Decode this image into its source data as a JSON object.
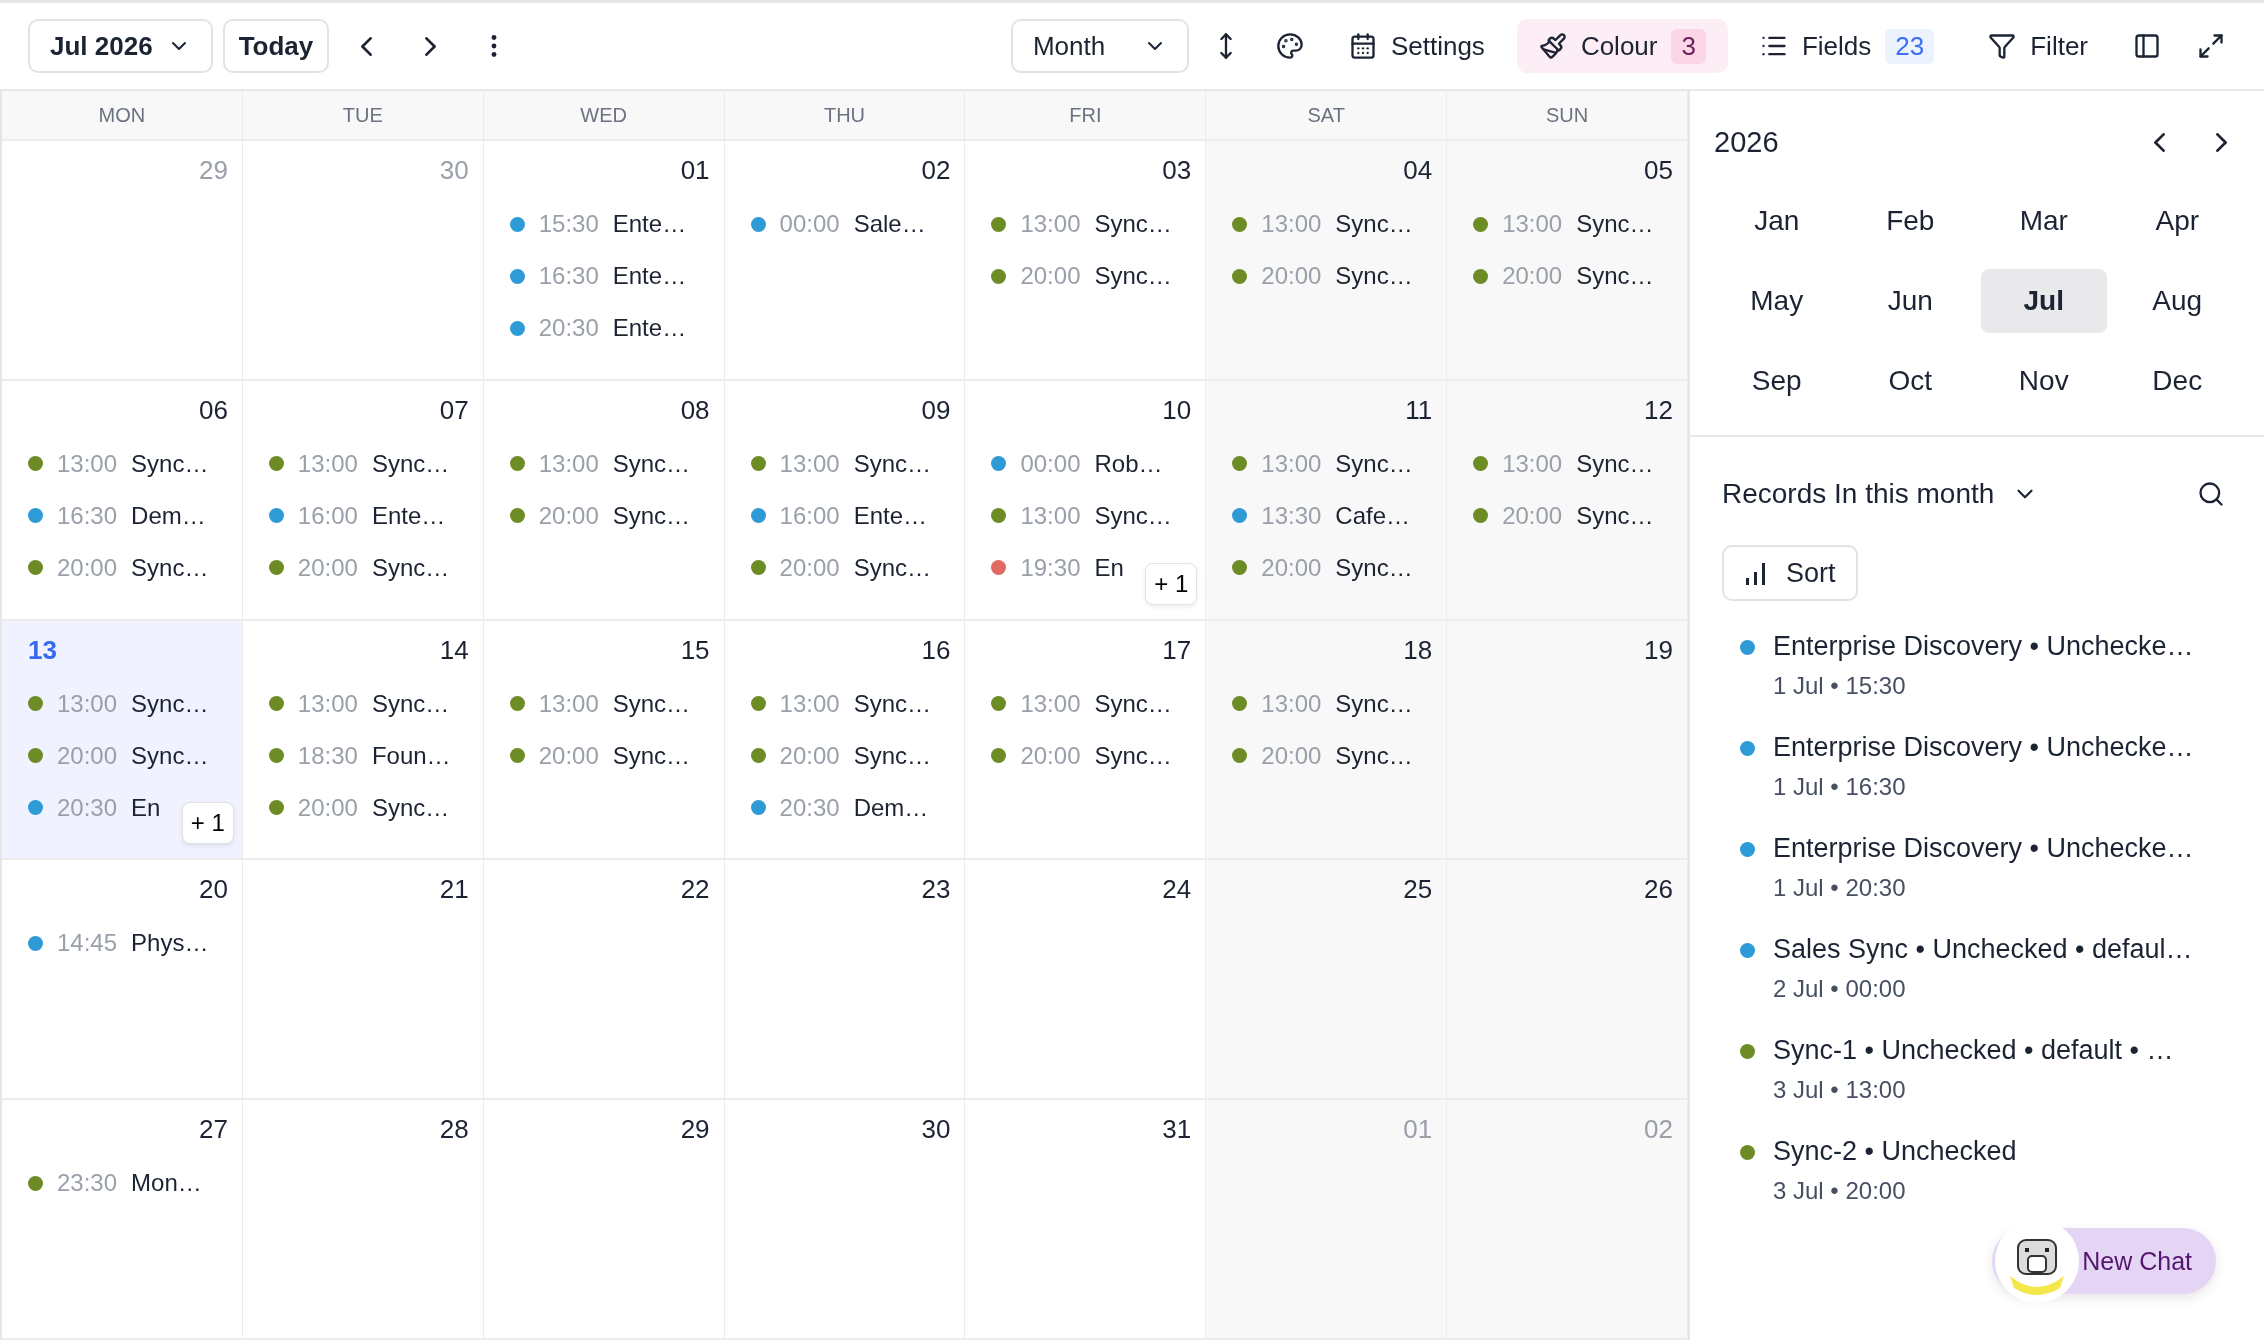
{
  "toolbar": {
    "date_picker": "Jul 2026",
    "today": "Today",
    "view": "Month",
    "settings": "Settings",
    "colour": {
      "label": "Colour",
      "count": "3"
    },
    "fields": {
      "label": "Fields",
      "count": "23"
    },
    "filter": "Filter"
  },
  "weekdays": [
    "MON",
    "TUE",
    "WED",
    "THU",
    "FRI",
    "SAT",
    "SUN"
  ],
  "weeks": [
    {
      "days": [
        {
          "date": "29",
          "in_month": false,
          "today": false
        },
        {
          "date": "30",
          "in_month": false,
          "today": false
        },
        {
          "date": "01",
          "in_month": true,
          "today": false,
          "events": [
            {
              "color": "#2e9bd6",
              "time": "15:30",
              "title": "Ente…"
            },
            {
              "color": "#2e9bd6",
              "time": "16:30",
              "title": "Ente…"
            },
            {
              "color": "#2e9bd6",
              "time": "20:30",
              "title": "Ente…"
            }
          ]
        },
        {
          "date": "02",
          "in_month": true,
          "today": false,
          "events": [
            {
              "color": "#2e9bd6",
              "time": "00:00",
              "title": "Sale…"
            }
          ]
        },
        {
          "date": "03",
          "in_month": true,
          "today": false,
          "events": [
            {
              "color": "#6e8c25",
              "time": "13:00",
              "title": "Sync…"
            },
            {
              "color": "#6e8c25",
              "time": "20:00",
              "title": "Sync…"
            }
          ]
        },
        {
          "date": "04",
          "in_month": true,
          "today": false,
          "events": [
            {
              "color": "#6e8c25",
              "time": "13:00",
              "title": "Sync…"
            },
            {
              "color": "#6e8c25",
              "time": "20:00",
              "title": "Sync…"
            }
          ]
        },
        {
          "date": "05",
          "in_month": true,
          "today": false,
          "events": [
            {
              "color": "#6e8c25",
              "time": "13:00",
              "title": "Sync…"
            },
            {
              "color": "#6e8c25",
              "time": "20:00",
              "title": "Sync…"
            }
          ]
        }
      ]
    },
    {
      "days": [
        {
          "date": "06",
          "in_month": true,
          "today": false,
          "events": [
            {
              "color": "#6e8c25",
              "time": "13:00",
              "title": "Sync…"
            },
            {
              "color": "#2e9bd6",
              "time": "16:30",
              "title": "Dem…"
            },
            {
              "color": "#6e8c25",
              "time": "20:00",
              "title": "Sync…"
            }
          ]
        },
        {
          "date": "07",
          "in_month": true,
          "today": false,
          "events": [
            {
              "color": "#6e8c25",
              "time": "13:00",
              "title": "Sync…"
            },
            {
              "color": "#2e9bd6",
              "time": "16:00",
              "title": "Ente…"
            },
            {
              "color": "#6e8c25",
              "time": "20:00",
              "title": "Sync…"
            }
          ]
        },
        {
          "date": "08",
          "in_month": true,
          "today": false,
          "events": [
            {
              "color": "#6e8c25",
              "time": "13:00",
              "title": "Sync…"
            },
            {
              "color": "#6e8c25",
              "time": "20:00",
              "title": "Sync…"
            }
          ]
        },
        {
          "date": "09",
          "in_month": true,
          "today": false,
          "events": [
            {
              "color": "#6e8c25",
              "time": "13:00",
              "title": "Sync…"
            },
            {
              "color": "#2e9bd6",
              "time": "16:00",
              "title": "Ente…"
            },
            {
              "color": "#6e8c25",
              "time": "20:00",
              "title": "Sync…"
            }
          ]
        },
        {
          "date": "10",
          "in_month": true,
          "today": false,
          "events": [
            {
              "color": "#2e9bd6",
              "time": "00:00",
              "title": "Rob…"
            },
            {
              "color": "#6e8c25",
              "time": "13:00",
              "title": "Sync…"
            },
            {
              "color": "#e06a62",
              "time": "19:30",
              "title": "En"
            }
          ],
          "more": "+ 1"
        },
        {
          "date": "11",
          "in_month": true,
          "today": false,
          "events": [
            {
              "color": "#6e8c25",
              "time": "13:00",
              "title": "Sync…"
            },
            {
              "color": "#2e9bd6",
              "time": "13:30",
              "title": "Cafe…"
            },
            {
              "color": "#6e8c25",
              "time": "20:00",
              "title": "Sync…"
            }
          ]
        },
        {
          "date": "12",
          "in_month": true,
          "today": false,
          "events": [
            {
              "color": "#6e8c25",
              "time": "13:00",
              "title": "Sync…"
            },
            {
              "color": "#6e8c25",
              "time": "20:00",
              "title": "Sync…"
            }
          ]
        }
      ]
    },
    {
      "days": [
        {
          "date": "13",
          "in_month": true,
          "today": true,
          "events": [
            {
              "color": "#6e8c25",
              "time": "13:00",
              "title": "Sync…"
            },
            {
              "color": "#6e8c25",
              "time": "20:00",
              "title": "Sync…"
            },
            {
              "color": "#2e9bd6",
              "time": "20:30",
              "title": "En"
            }
          ],
          "more": "+ 1"
        },
        {
          "date": "14",
          "in_month": true,
          "today": false,
          "events": [
            {
              "color": "#6e8c25",
              "time": "13:00",
              "title": "Sync…"
            },
            {
              "color": "#6e8c25",
              "time": "18:30",
              "title": "Foun…"
            },
            {
              "color": "#6e8c25",
              "time": "20:00",
              "title": "Sync…"
            }
          ]
        },
        {
          "date": "15",
          "in_month": true,
          "today": false,
          "events": [
            {
              "color": "#6e8c25",
              "time": "13:00",
              "title": "Sync…"
            },
            {
              "color": "#6e8c25",
              "time": "20:00",
              "title": "Sync…"
            }
          ]
        },
        {
          "date": "16",
          "in_month": true,
          "today": false,
          "events": [
            {
              "color": "#6e8c25",
              "time": "13:00",
              "title": "Sync…"
            },
            {
              "color": "#6e8c25",
              "time": "20:00",
              "title": "Sync…"
            },
            {
              "color": "#2e9bd6",
              "time": "20:30",
              "title": "Dem…"
            }
          ]
        },
        {
          "date": "17",
          "in_month": true,
          "today": false,
          "events": [
            {
              "color": "#6e8c25",
              "time": "13:00",
              "title": "Sync…"
            },
            {
              "color": "#6e8c25",
              "time": "20:00",
              "title": "Sync…"
            }
          ]
        },
        {
          "date": "18",
          "in_month": true,
          "today": false,
          "events": [
            {
              "color": "#6e8c25",
              "time": "13:00",
              "title": "Sync…"
            },
            {
              "color": "#6e8c25",
              "time": "20:00",
              "title": "Sync…"
            }
          ]
        },
        {
          "date": "19",
          "in_month": true,
          "today": false
        }
      ]
    },
    {
      "days": [
        {
          "date": "20",
          "in_month": true,
          "today": false,
          "events": [
            {
              "color": "#2e9bd6",
              "time": "14:45",
              "title": "Phys…"
            }
          ]
        },
        {
          "date": "21",
          "in_month": true,
          "today": false
        },
        {
          "date": "22",
          "in_month": true,
          "today": false
        },
        {
          "date": "23",
          "in_month": true,
          "today": false
        },
        {
          "date": "24",
          "in_month": true,
          "today": false
        },
        {
          "date": "25",
          "in_month": true,
          "today": false
        },
        {
          "date": "26",
          "in_month": true,
          "today": false
        }
      ]
    },
    {
      "days": [
        {
          "date": "27",
          "in_month": true,
          "today": false,
          "events": [
            {
              "color": "#6e8c25",
              "time": "23:30",
              "title": "Mon…"
            }
          ]
        },
        {
          "date": "28",
          "in_month": true,
          "today": false
        },
        {
          "date": "29",
          "in_month": true,
          "today": false
        },
        {
          "date": "30",
          "in_month": true,
          "today": false
        },
        {
          "date": "31",
          "in_month": true,
          "today": false
        },
        {
          "date": "01",
          "in_month": false,
          "today": false
        },
        {
          "date": "02",
          "in_month": false,
          "today": false
        }
      ]
    }
  ],
  "sidebar": {
    "year": "2026",
    "months": [
      {
        "label": "Jan",
        "selected": false
      },
      {
        "label": "Feb",
        "selected": false
      },
      {
        "label": "Mar",
        "selected": false
      },
      {
        "label": "Apr",
        "selected": false
      },
      {
        "label": "May",
        "selected": false
      },
      {
        "label": "Jun",
        "selected": false
      },
      {
        "label": "Jul",
        "selected": true
      },
      {
        "label": "Aug",
        "selected": false
      },
      {
        "label": "Sep",
        "selected": false
      },
      {
        "label": "Oct",
        "selected": false
      },
      {
        "label": "Nov",
        "selected": false
      },
      {
        "label": "Dec",
        "selected": false
      }
    ],
    "records_title": "Records In this month",
    "sort": "Sort",
    "records": [
      {
        "color": "#2e9bd6",
        "title": "Enterprise Discovery • Unchecke…",
        "subtitle": "1 Jul • 15:30"
      },
      {
        "color": "#2e9bd6",
        "title": "Enterprise Discovery • Unchecke…",
        "subtitle": "1 Jul • 16:30"
      },
      {
        "color": "#2e9bd6",
        "title": "Enterprise Discovery • Unchecke…",
        "subtitle": "1 Jul • 20:30"
      },
      {
        "color": "#2e9bd6",
        "title": "Sales Sync • Unchecked • defaul…",
        "subtitle": "2 Jul • 00:00"
      },
      {
        "color": "#6e8c25",
        "title": "Sync-1 • Unchecked • default • …",
        "subtitle": "3 Jul • 13:00"
      },
      {
        "color": "#6e8c25",
        "title": "Sync-2 • Unchecked",
        "subtitle": "3 Jul • 20:00"
      }
    ],
    "chat_button": "New Chat"
  }
}
